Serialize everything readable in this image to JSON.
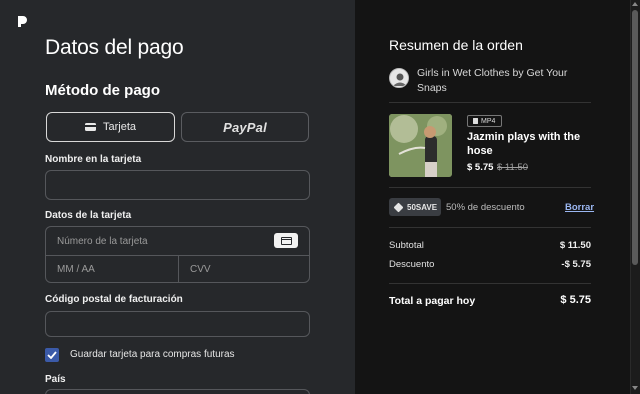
{
  "app": {
    "logo": "patreon-logo-icon"
  },
  "payment": {
    "title": "Datos del pago",
    "method_heading": "Método de pago",
    "methods": [
      {
        "label": "Tarjeta",
        "icon": "credit-card-icon",
        "selected": true
      },
      {
        "label": "PayPal",
        "icon": "paypal-logo",
        "selected": false
      }
    ],
    "name_label": "Nombre en la tarjeta",
    "name_value": "",
    "card_label": "Datos de la tarjeta",
    "card_number_placeholder": "Número de la tarjeta",
    "expiry_placeholder": "MM / AA",
    "cvv_placeholder": "CVV",
    "postal_label": "Código postal de facturación",
    "postal_value": "",
    "save_card_label": "Guardar tarjeta para compras futuras",
    "save_card_checked": true,
    "country_label": "País"
  },
  "summary": {
    "title": "Resumen de la orden",
    "creator_name": "Girls in Wet Clothes by Get Your Snaps",
    "item": {
      "format": "MP4",
      "title": "Jazmin plays with the hose",
      "price": "$ 5.75",
      "original_price": "$ 11.50"
    },
    "promo": {
      "code": "50SAVE",
      "description": "50% de descuento",
      "remove_label": "Borrar"
    },
    "rows": [
      {
        "label": "Subtotal",
        "value": "$ 11.50"
      },
      {
        "label": "Descuento",
        "value": "-$ 5.75"
      }
    ],
    "total_label": "Total a pagar hoy",
    "total_value": "$ 5.75"
  },
  "colors": {
    "left_bg": "#26282b",
    "right_bg": "#141414",
    "accent_checkbox": "#3b5aa8",
    "link": "#9bb7f2"
  }
}
